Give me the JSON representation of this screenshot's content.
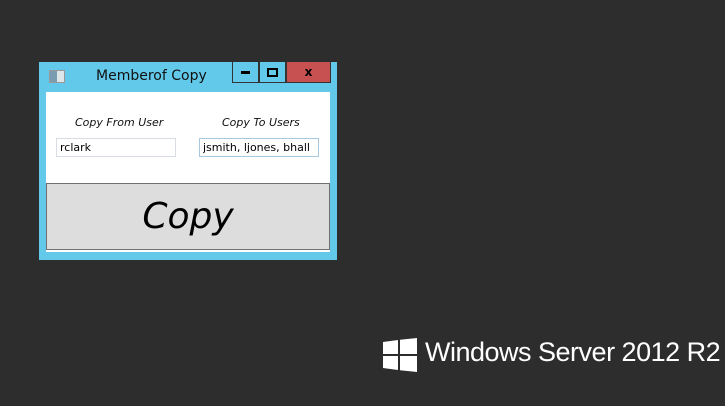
{
  "window": {
    "title": "Memberof Copy",
    "minimize": "▬",
    "maximize": "□",
    "close": "x"
  },
  "form": {
    "from_label": "Copy From User",
    "to_label": "Copy To Users",
    "from_value": "rclark",
    "to_value": "jsmith, ljones, bhall",
    "copy_button": "Copy"
  },
  "desktop": {
    "branding": "Windows Server 2012 R2"
  },
  "colors": {
    "title_bar": "#63c9ea",
    "close": "#c75050",
    "desktop": "#2d2d2d"
  }
}
